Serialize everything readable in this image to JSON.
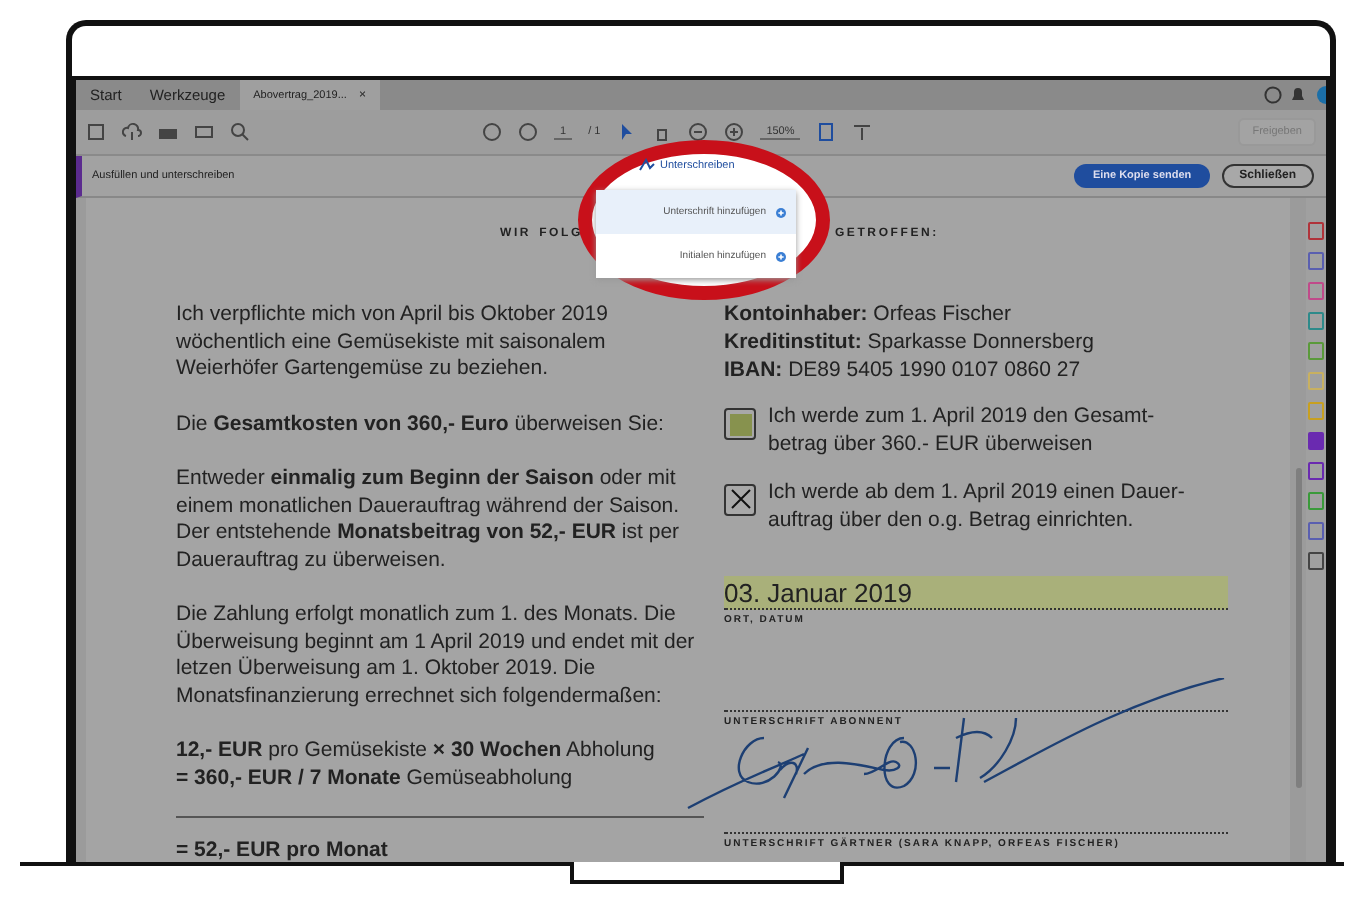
{
  "tabs": [
    {
      "label": "Start",
      "selected": false
    },
    {
      "label": "Werkzeuge",
      "selected": false
    },
    {
      "label": "Abovertrag_2019...",
      "selected": true,
      "close": "×"
    }
  ],
  "toolbar": {
    "page": "1",
    "page_total": "/ 1",
    "zoom": "150%",
    "share": "Freigeben"
  },
  "fill_sign_bar": {
    "title": "Ausfüllen und unterschreiben",
    "sign_button": "Unterschreiben",
    "send_button": "Eine Kopie senden",
    "close_button": "Schließen"
  },
  "sign_menu": [
    {
      "label": "Unterschrift hinzufügen",
      "selected": true
    },
    {
      "label": "Initialen hinzufügen",
      "selected": false
    }
  ],
  "document": {
    "heading_left": [
      "WIR",
      "FOLG"
    ],
    "heading_right": "GETROFFEN:",
    "left_paragraphs": [
      "Ich verpflichte mich von April bis Oktober 2019 wöchentlich eine Gemüsekiste mit saisonalem Weierhöfer Gartengemüse zu beziehen.",
      "Die **Gesamtkosten von 360,- Euro** überweisen Sie:",
      "Entweder **einmalig zum Beginn der Saison** oder mit einem monatlichen Dauerauftrag während der Saison. Der entstehende **Monatsbeitrag von 52,- EUR** ist per Dauerauftrag zu überweisen.",
      "Die Zahlung erfolgt monatlich zum 1. des Monats. Die Überweisung beginnt am 1 April 2019 und endet mit der letzen Überweisung am 1. Oktober 2019. Die Monatsfinanzierung errechnet sich folgendermaßen:",
      "**12,- EUR** pro Gemüsekiste **× 30 Wochen** Abholung\n**= 360,- EUR / 7 Monate** Gemüseabholung"
    ],
    "total": "= 52,- EUR pro Monat",
    "account": [
      "**Kontoinhaber:** Orfeas Fischer",
      "**Kreditinstitut:** Sparkasse Donnersberg",
      "**IBAN:** DE89 5405 1990 0107 0860 27"
    ],
    "options": [
      {
        "kind": "filled",
        "text": "Ich werde zum 1. April 2019 den Gesamt-\nbetrag über 360.- EUR überweisen"
      },
      {
        "kind": "crossed",
        "text": "Ich werde ab dem 1. April 2019 einen Dauer-\nauftrag über den o.g. Betrag einrichten."
      }
    ],
    "date": "03. Januar 2019",
    "date_label": "ORT, DATUM",
    "signature_label": "UNTERSCHRIFT ABONNENT",
    "gardener_label": "UNTERSCHRIFT GÄRTNER (SARA KNAPP, ORFEAS FISCHER)"
  }
}
